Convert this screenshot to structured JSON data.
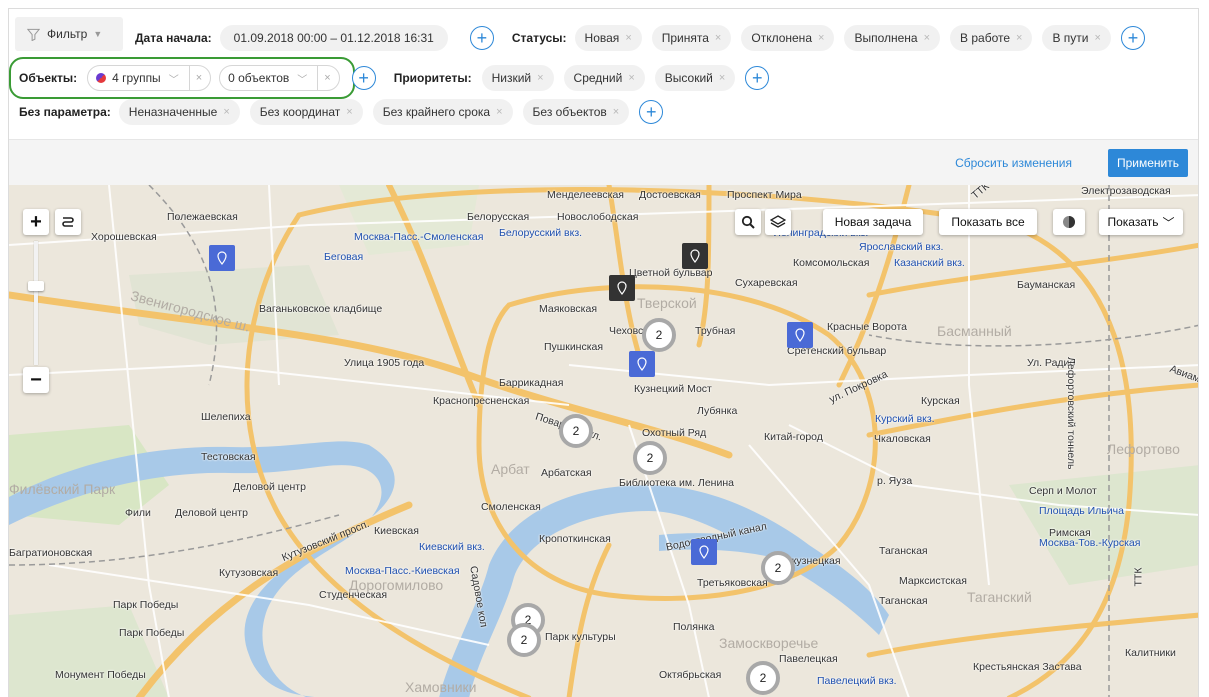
{
  "filters": {
    "filter_button": "Фильтр",
    "date": {
      "label": "Дата начала:",
      "value": "01.09.2018 00:00 – 01.12.2018 16:31"
    },
    "statuses": {
      "label": "Статусы:",
      "items": [
        "Новая",
        "Принята",
        "Отклонена",
        "Выполнена",
        "В работе",
        "В пути"
      ]
    },
    "objects": {
      "label": "Объекты:",
      "groups_value": "4 группы",
      "objects_value": "0 объектов"
    },
    "priorities": {
      "label": "Приоритеты:",
      "items": [
        "Низкий",
        "Средний",
        "Высокий"
      ]
    },
    "no_param": {
      "label": "Без параметра:",
      "items": [
        "Неназначенные",
        "Без координат",
        "Без крайнего срока",
        "Без объектов"
      ]
    },
    "clear_glyph": "×",
    "plus_glyph": "+"
  },
  "actions": {
    "reset": "Сбросить изменения",
    "apply": "Применить"
  },
  "map_controls": {
    "new_task": "Новая задача",
    "show_all": "Показать все",
    "show": "Показать"
  },
  "map_labels": {
    "menedeleevskaya": "Менделеевская",
    "dostoevskaya": "Достоевская",
    "prospekt_mira": "Проспект Мира",
    "elektrozavodskaya": "Электрозаводская",
    "polezhaevskaya": "Полежаевская",
    "begovaya": "Беговая",
    "khoroshevskaya": "Хорошевская",
    "belorusskaya": "Белорусская",
    "novoslobodskaya": "Новослободская",
    "mosk_smolensk": "Москва-Пасс.-Смоленская",
    "belorussky_vkz": "Белорусский вкз.",
    "leningradsky": "Ленинградский вкз.",
    "yaroslavsky": "Ярославский вкз.",
    "komsomolskaya": "Комсомольская",
    "kazansky": "Казанский вкз.",
    "baumanskaya": "Бауманская",
    "tsvetnoy": "Цветной бульвар",
    "sukharevskaya": "Сухаревская",
    "zvenigorodskoe": "Звенигородское ш.",
    "vagankovskoe": "Ваганьковское кладбище",
    "mayakovskaya": "Маяковская",
    "tverskoy": "Тверской",
    "chekhovskaya": "Чеховская",
    "trubnaya": "Трубная",
    "krasnye_vorota": "Красные Ворота",
    "basmanny": "Басманный",
    "pushkinskaya": "Пушкинская",
    "sretensky": "Сретенский бульвар",
    "ulitsa_1905": "Улица 1905 года",
    "ul_radio": "Ул. Радио",
    "barrikadnaya": "Баррикадная",
    "kuznetsky": "Кузнецкий Мост",
    "krasnopresnenskaya": "Краснопресненская",
    "ul_pokrovka": "ул. Покровка",
    "kurskaya": "Курская",
    "kursky_vkz": "Курский вкз.",
    "shelepikha": "Шелепиха",
    "lubyanka": "Лубянка",
    "okhotny": "Охотный Ряд",
    "kitay_gorod": "Китай-город",
    "chkalovskaya": "Чкаловская",
    "lefortovo": "Лефортово",
    "lefortovo_tunnel": "Лефортовский тоннель",
    "povarskaya": "Поварская ул.",
    "arbatskaya": "Арбатская",
    "testovskaya": "Тестовская",
    "arbat": "Арбат",
    "biblioteka": "Библиотека им. Ленина",
    "r_yauza": "р. Яуза",
    "serp_molot": "Серп и Молот",
    "ploshchad_ilicha": "Площадь Ильича",
    "filevsky_park": "Филёвский Парк",
    "delovoy": "Деловой центр",
    "smolenskaya": "Смоленская",
    "fili": "Фили",
    "kutuzovsky": "Кутузовский просп.",
    "kievskaya": "Киевская",
    "kievsky_vkz": "Киевский вкз.",
    "kropotkinskaya": "Кропоткинская",
    "rimskaya": "Римская",
    "moskva_tov_kurskaya": "Москва-Тов.-Курская",
    "bagrationovskaya": "Багратионовская",
    "mosk_kievskaya": "Москва-Пасс.-Киевская",
    "taganskaya": "Таганская",
    "kutuzovskaya": "Кутузовская",
    "dorogomilovo": "Дорогомилово",
    "studencheskaya": "Студенческая",
    "tretyakovskaya": "Третьяковская",
    "marksistskaya": "Марксистская",
    "tagansky": "Таганский",
    "park_pobedy": "Парк Победы",
    "sadovoe": "Садовое кол",
    "park_kultury": "Парк культуры",
    "polyanka": "Полянка",
    "zamoskvorechye": "Замоскворечье",
    "paveletskaya": "Павелецкая",
    "paveletsky": "Павелецкий вкз.",
    "krestyanskaya": "Крестьянская Застава",
    "monument": "Монумент Победы",
    "khamovniki": "Хамовники",
    "oktyabrskaya": "Октябрьская",
    "kalitniki": "Калитники",
    "ttk": "ТТК",
    "vodootvodny": "Водоотводный канал",
    "novokuznetskaya": "Новокузнецкая",
    "aviamotornaya": "Авиамо"
  },
  "clusters": [
    "2",
    "2",
    "2",
    "2",
    "2",
    "2",
    "2"
  ]
}
